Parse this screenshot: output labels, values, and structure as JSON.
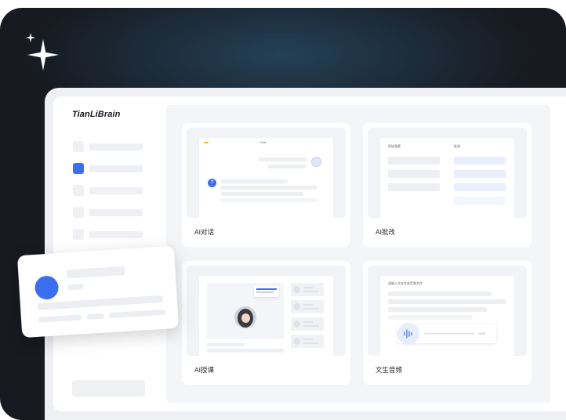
{
  "brand": "TianLiBrain",
  "cards": [
    {
      "label": "AI对话",
      "preview": {
        "header": "Chat",
        "avatar_letter": "T"
      }
    },
    {
      "label": "AI批改",
      "preview": {
        "col1": "原始答题",
        "col2": "批改"
      }
    },
    {
      "label": "AI授课",
      "preview": {}
    },
    {
      "label": "文生音频",
      "preview": {
        "prompt": "请输入文本生成音频文件",
        "time": "3:00"
      }
    }
  ],
  "colors": {
    "accent": "#3b6ff0",
    "background_dark": "#171a21"
  }
}
